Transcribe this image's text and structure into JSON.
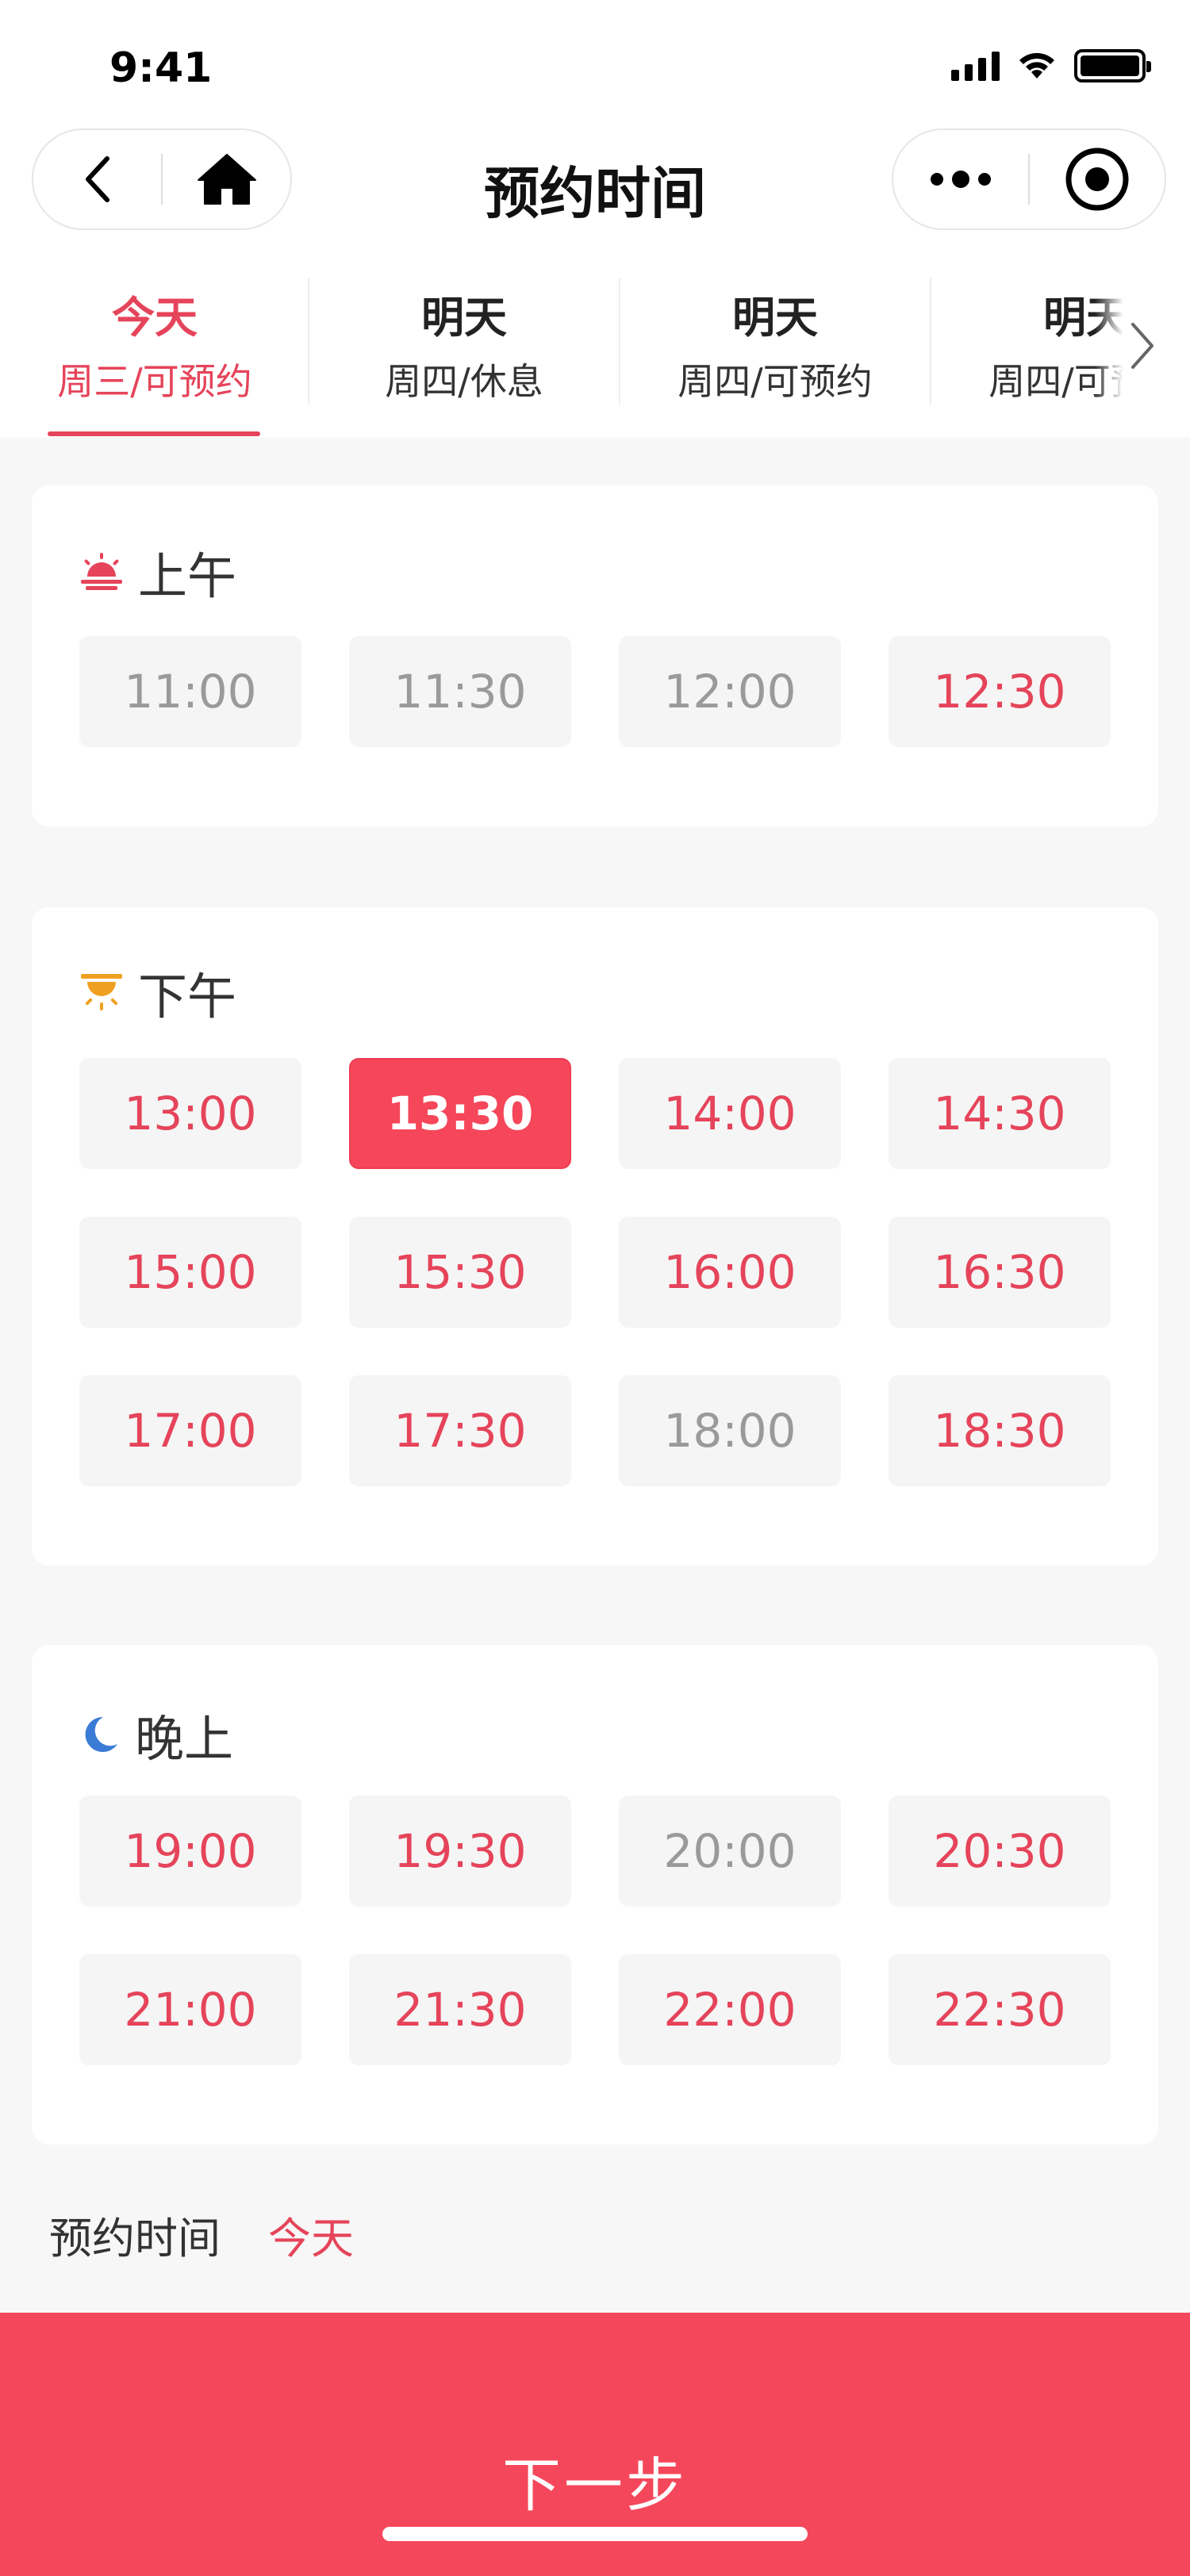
{
  "status_bar": {
    "time": "9:41"
  },
  "nav": {
    "title": "预约时间"
  },
  "date_tabs": [
    {
      "day": "今天",
      "sub": "周三/可预约",
      "active": true
    },
    {
      "day": "明天",
      "sub": "周四/休息",
      "active": false
    },
    {
      "day": "明天",
      "sub": "周四/可预约",
      "active": false
    },
    {
      "day": "明天",
      "sub": "周四/可预约",
      "active": false
    }
  ],
  "sections": {
    "morning": {
      "title": "上午",
      "slots": [
        {
          "time": "11:00",
          "state": "disabled"
        },
        {
          "time": "11:30",
          "state": "disabled"
        },
        {
          "time": "12:00",
          "state": "disabled"
        },
        {
          "time": "12:30",
          "state": "available"
        }
      ]
    },
    "afternoon": {
      "title": "下午",
      "slots": [
        {
          "time": "13:00",
          "state": "available"
        },
        {
          "time": "13:30",
          "state": "selected"
        },
        {
          "time": "14:00",
          "state": "available"
        },
        {
          "time": "14:30",
          "state": "available"
        },
        {
          "time": "15:00",
          "state": "available"
        },
        {
          "time": "15:30",
          "state": "available"
        },
        {
          "time": "16:00",
          "state": "available"
        },
        {
          "time": "16:30",
          "state": "available"
        },
        {
          "time": "17:00",
          "state": "available"
        },
        {
          "time": "17:30",
          "state": "available"
        },
        {
          "time": "18:00",
          "state": "disabled"
        },
        {
          "time": "18:30",
          "state": "available"
        }
      ]
    },
    "evening": {
      "title": "晚上",
      "slots": [
        {
          "time": "19:00",
          "state": "available"
        },
        {
          "time": "19:30",
          "state": "available"
        },
        {
          "time": "20:00",
          "state": "disabled"
        },
        {
          "time": "20:30",
          "state": "available"
        },
        {
          "time": "21:00",
          "state": "available"
        },
        {
          "time": "21:30",
          "state": "available"
        },
        {
          "time": "22:00",
          "state": "available"
        },
        {
          "time": "22:30",
          "state": "available"
        }
      ]
    }
  },
  "summary": {
    "label": "预约时间",
    "value": "今天"
  },
  "footer": {
    "next_label": "下一步"
  },
  "colors": {
    "accent": "#f5475b",
    "available_text": "#e5445a",
    "disabled_text": "#9a9a9a",
    "slot_bg": "#f5f5f5",
    "morning_icon": "#e5445a",
    "afternoon_icon": "#f0a020",
    "evening_icon": "#3a7bd5"
  },
  "icons": {
    "morning": "sunrise-icon",
    "afternoon": "sunset-icon",
    "evening": "moon-icon"
  }
}
